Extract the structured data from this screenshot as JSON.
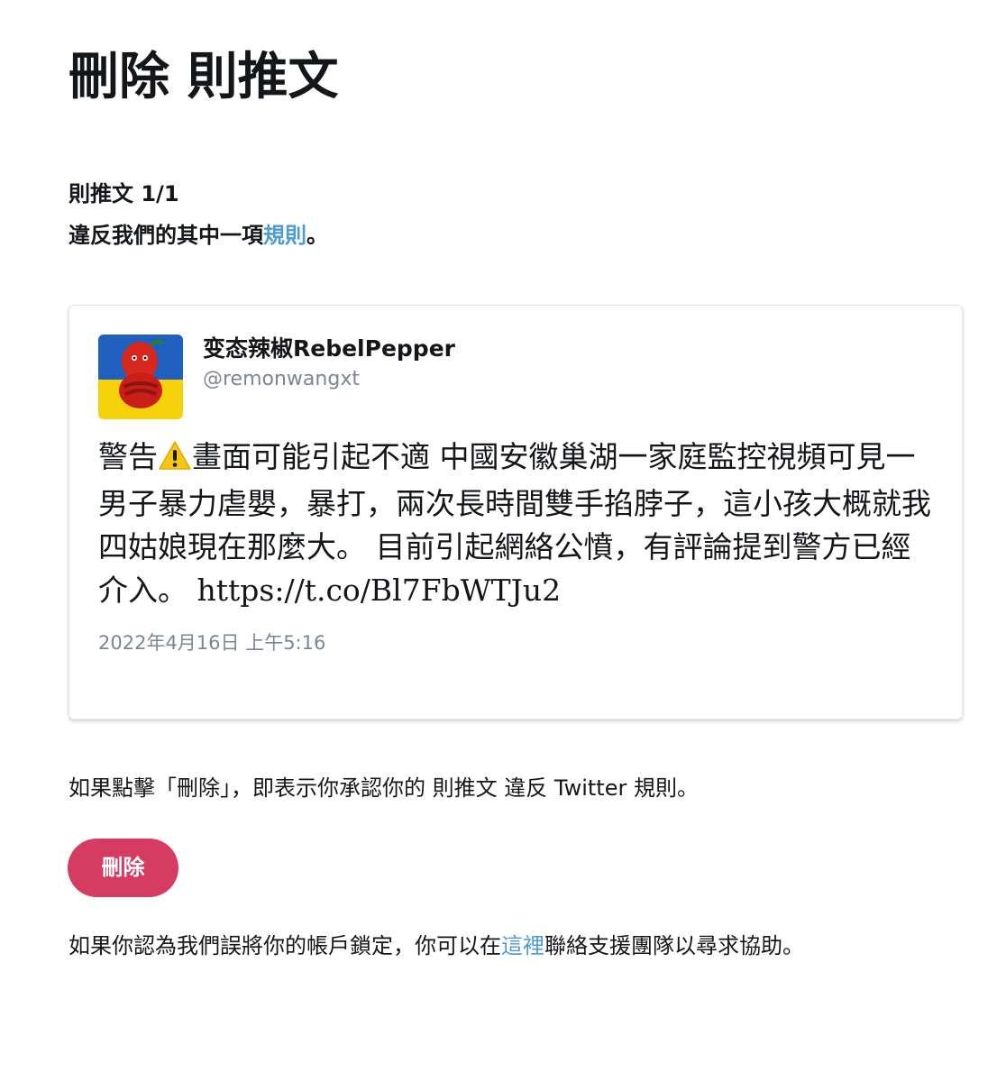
{
  "page": {
    "title": "刪除 則推文"
  },
  "notice": {
    "count": "則推文 1/1",
    "violation_prefix": "違反我們的其中一項",
    "rules_link": "規則",
    "violation_suffix": "。"
  },
  "tweet": {
    "display_name": "变态辣椒RebelPepper",
    "handle": "@remonwangxt",
    "text_before_icon": "警告",
    "warning_icon": "warning-icon",
    "text_main": "畫面可能引起不適 中國安徽巢湖一家庭監控視頻可見一男子暴力虐嬰，暴打，兩次長時間雙手掐脖子，這小孩大概就我四姑娘現在那麼大。 目前引起網絡公憤，有評論提到警方已經介入。 ",
    "url": "https://t.co/Bl7FbWTJu2",
    "timestamp": "2022年4月16日 上午5:16",
    "avatar_colors": {
      "top": "#1f5fbf",
      "bottom": "#f5d20c",
      "pepper": "#d8281e"
    }
  },
  "confirm": {
    "text": "如果點擊「刪除」，即表示你承認你的 則推文 違反 Twitter 規則。"
  },
  "actions": {
    "delete_label": "刪除",
    "delete_color": "#d63c62"
  },
  "support": {
    "prefix": "如果你認為我們誤將你的帳戶鎖定，你可以在",
    "link": "這裡",
    "suffix": "聯絡支援團隊以尋求協助。"
  },
  "colors": {
    "link": "#4e9bd6",
    "muted": "#7a8691",
    "text": "#14171a"
  }
}
